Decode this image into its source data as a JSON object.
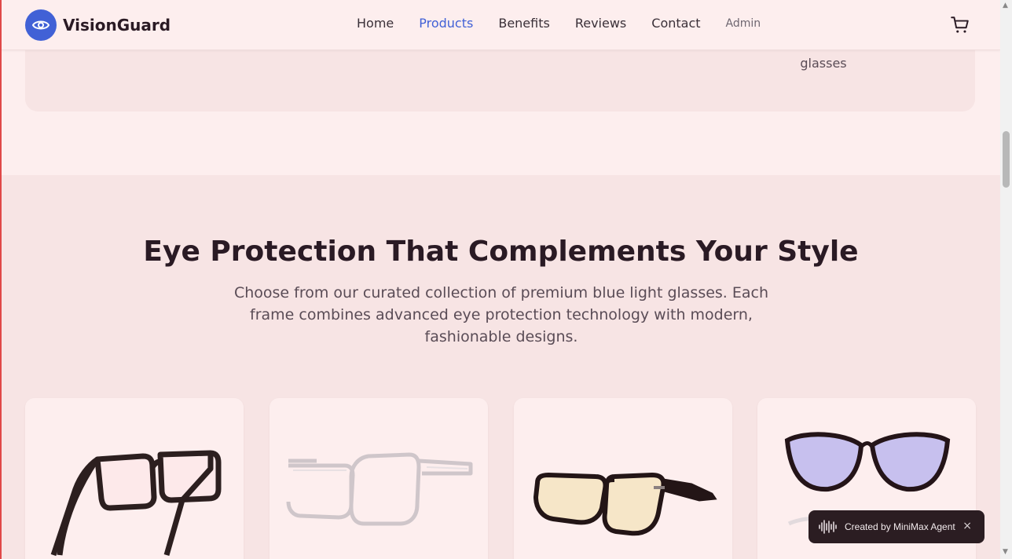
{
  "header": {
    "brand": "VisionGuard",
    "nav": [
      {
        "label": "Home",
        "active": false
      },
      {
        "label": "Products",
        "active": true
      },
      {
        "label": "Benefits",
        "active": false
      },
      {
        "label": "Reviews",
        "active": false
      },
      {
        "label": "Contact",
        "active": false
      }
    ],
    "admin_label": "Admin",
    "icons": {
      "logo": "eye-icon",
      "cart": "cart-icon"
    },
    "accent_color": "#4161d6"
  },
  "top_panel": {
    "visible_text": "glasses"
  },
  "products_section": {
    "title": "Eye Protection That Complements Your Style",
    "subtitle": "Choose from our curated collection of premium blue light glasses. Each frame combines advanced eye protection technology with modern, fashionable designs.",
    "cards": [
      {
        "image": "black-square-frame-glasses"
      },
      {
        "image": "clear-frame-glasses"
      },
      {
        "image": "black-amber-lens-glasses"
      },
      {
        "image": "black-cat-eye-glasses"
      }
    ]
  },
  "badge": {
    "text": "Created by MiniMax Agent",
    "close": "×",
    "icon": "waveform-icon"
  }
}
